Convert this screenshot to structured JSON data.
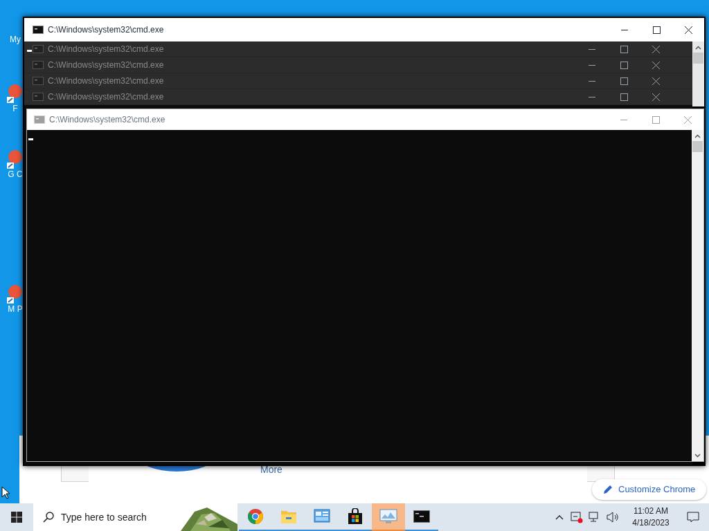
{
  "desktop": {
    "icons": [
      {
        "label": "My",
        "kind": "label"
      },
      {
        "label": "F",
        "kind": "shortcut"
      },
      {
        "label": "G C",
        "kind": "shortcut"
      },
      {
        "label": "M P",
        "kind": "shortcut"
      }
    ]
  },
  "browser": {
    "link": "More",
    "customize_button": "Customize Chrome"
  },
  "back_window": {
    "title": "C:\\Windows\\system32\\cmd.exe",
    "ghost_titles": [
      "C:\\Windows\\system32\\cmd.exe",
      "C:\\Windows\\system32\\cmd.exe",
      "C:\\Windows\\system32\\cmd.exe",
      "C:\\Windows\\system32\\cmd.exe"
    ]
  },
  "front_window": {
    "title": "C:\\Windows\\system32\\cmd.exe"
  },
  "taskbar": {
    "search": {
      "placeholder": "Type here to search"
    },
    "apps": [
      {
        "kind": "chrome",
        "active": false
      },
      {
        "kind": "folder",
        "active": false
      },
      {
        "kind": "control",
        "active": false
      },
      {
        "kind": "store",
        "active": false
      },
      {
        "kind": "monitor",
        "active": true
      },
      {
        "kind": "terminal",
        "active": false
      }
    ],
    "time": "11:02 AM",
    "date": "4/18/2023"
  }
}
